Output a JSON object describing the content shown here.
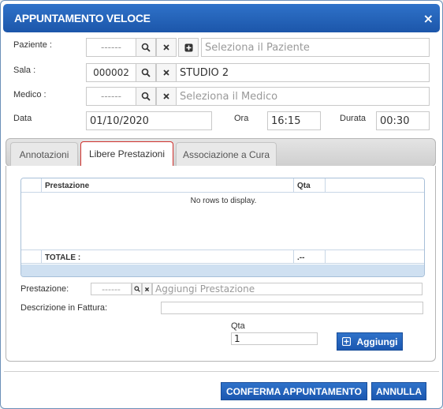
{
  "dialog": {
    "title": "APPUNTAMENTO VELOCE",
    "close_glyph": "×"
  },
  "form": {
    "paziente": {
      "label": "Paziente :",
      "code": "------",
      "placeholder": "Seleziona il Paziente"
    },
    "sala": {
      "label": "Sala :",
      "code": "000002",
      "value": "STUDIO 2"
    },
    "medico": {
      "label": "Medico :",
      "code": "------",
      "placeholder": "Seleziona il Medico"
    },
    "data": {
      "label": "Data",
      "value": "01/10/2020"
    },
    "ora": {
      "label": "Ora",
      "value": "16:15"
    },
    "durata": {
      "label": "Durata",
      "value": "00:30"
    }
  },
  "tabs": [
    {
      "label": "Annotazioni"
    },
    {
      "label": "Libere Prestazioni",
      "active": true
    },
    {
      "label": "Associazione a Cura"
    }
  ],
  "grid": {
    "columns": [
      "Prestazione",
      "Qta"
    ],
    "empty_text": "No rows to display.",
    "footer": {
      "label": "TOTALE :",
      "qta": ".--"
    }
  },
  "prestazione": {
    "label": "Prestazione:",
    "code": "------",
    "placeholder": "Aggiungi Prestazione"
  },
  "descrizione": {
    "label": "Descrizione in Fattura:",
    "value": ""
  },
  "qta": {
    "label": "Qta",
    "value": "1"
  },
  "buttons": {
    "aggiungi": "Aggiungi",
    "conferma": "CONFERMA APPUNTAMENTO",
    "annulla": "ANNULLA"
  },
  "icons": {
    "search": "search-icon",
    "clear": "close-icon",
    "add": "plus-square-icon"
  },
  "colors": {
    "accent": "#1c56aa",
    "active_tab_border": "#d0312d"
  }
}
